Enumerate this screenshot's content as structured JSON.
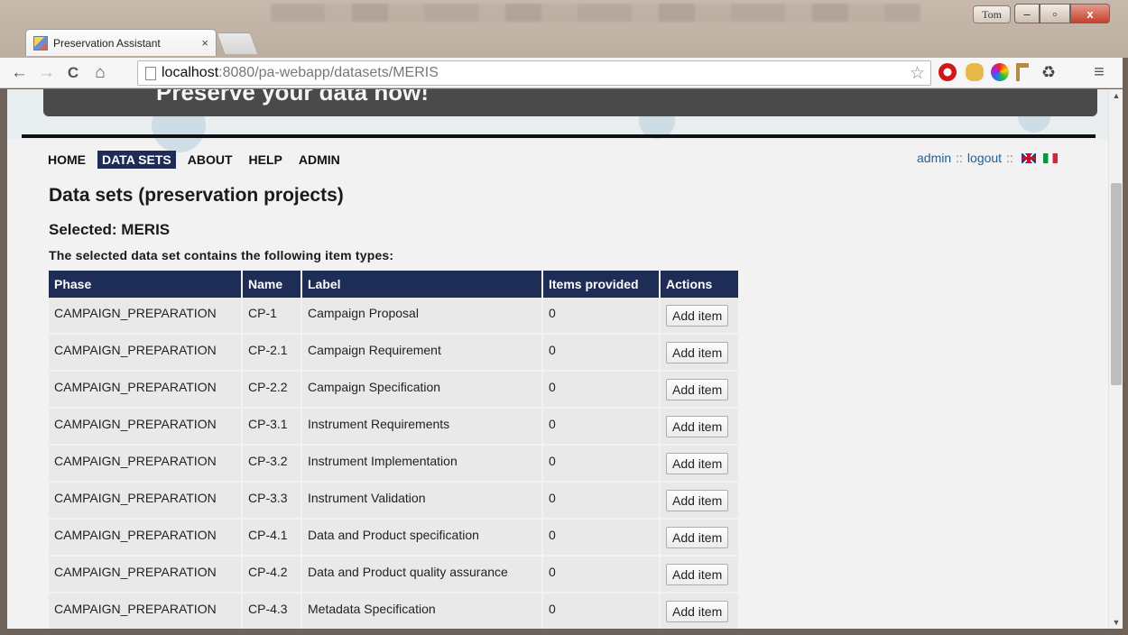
{
  "browser": {
    "tab_title": "Preservation Assistant",
    "tab_close": "×",
    "user_name": "Tom",
    "url_host": "localhost",
    "url_path": ":8080/pa-webapp/datasets/MERIS",
    "win_min": "–",
    "win_max": "▫",
    "win_close": "x",
    "nav_back": "←",
    "nav_forward": "→",
    "nav_reload": "C",
    "nav_home": "⌂",
    "star": "☆",
    "menu": "≡"
  },
  "banner": {
    "text": "Preserve your data now!"
  },
  "menu": {
    "items": [
      "HOME",
      "DATA SETS",
      "ABOUT",
      "HELP",
      "ADMIN"
    ]
  },
  "userlinks": {
    "user": "admin",
    "logout": "logout",
    "sep": "::"
  },
  "page": {
    "title": "Data sets (preservation projects)",
    "selected": "Selected: MERIS",
    "caption": "The selected data set contains the following item types:"
  },
  "table": {
    "headers": [
      "Phase",
      "Name",
      "Label",
      "Items provided",
      "Actions"
    ],
    "rows": [
      {
        "phase": "CAMPAIGN_PREPARATION",
        "name": "CP-1",
        "label": "Campaign Proposal",
        "items": "0",
        "action": "Add item"
      },
      {
        "phase": "CAMPAIGN_PREPARATION",
        "name": "CP-2.1",
        "label": "Campaign Requirement",
        "items": "0",
        "action": "Add item"
      },
      {
        "phase": "CAMPAIGN_PREPARATION",
        "name": "CP-2.2",
        "label": "Campaign Specification",
        "items": "0",
        "action": "Add item"
      },
      {
        "phase": "CAMPAIGN_PREPARATION",
        "name": "CP-3.1",
        "label": "Instrument Requirements",
        "items": "0",
        "action": "Add item"
      },
      {
        "phase": "CAMPAIGN_PREPARATION",
        "name": "CP-3.2",
        "label": "Instrument Implementation",
        "items": "0",
        "action": "Add item"
      },
      {
        "phase": "CAMPAIGN_PREPARATION",
        "name": "CP-3.3",
        "label": "Instrument Validation",
        "items": "0",
        "action": "Add item"
      },
      {
        "phase": "CAMPAIGN_PREPARATION",
        "name": "CP-4.1",
        "label": "Data and Product specification",
        "items": "0",
        "action": "Add item"
      },
      {
        "phase": "CAMPAIGN_PREPARATION",
        "name": "CP-4.2",
        "label": "Data and Product quality assurance",
        "items": "0",
        "action": "Add item"
      },
      {
        "phase": "CAMPAIGN_PREPARATION",
        "name": "CP-4.3",
        "label": "Metadata Specification",
        "items": "0",
        "action": "Add item"
      }
    ]
  },
  "colors": {
    "nav_bg": "#1e2d56",
    "link": "#1f5f9f",
    "cell_bg": "#e9e9e9"
  }
}
